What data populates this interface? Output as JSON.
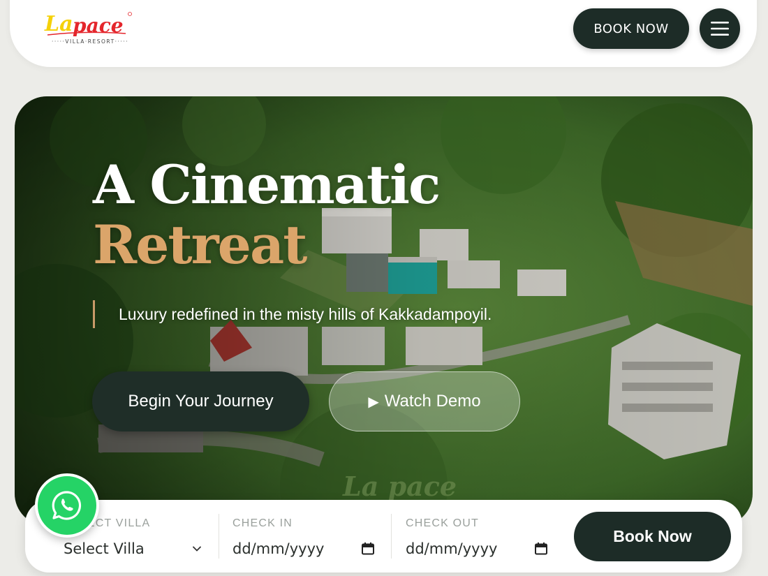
{
  "brand": {
    "logo_text": "La pace",
    "logo_subtext": "VILLA · RESORT",
    "primary_color": "#1d2c27",
    "accent_color": "#dba56a"
  },
  "header": {
    "book_now_label": "BOOK NOW",
    "menu_icon": "hamburger-menu-icon"
  },
  "hero": {
    "title_line1": "A Cinematic",
    "title_line2": "Retreat",
    "tagline": "Luxury redefined in the misty hills of Kakkadampoyil.",
    "primary_cta": "Begin Your Journey",
    "secondary_cta": "Watch Demo",
    "secondary_cta_icon": "play-icon",
    "watermark": "La pace"
  },
  "booking": {
    "villa_label": "SELECT VILLA",
    "villa_value": "Select Villa",
    "checkin_label": "CHECK IN",
    "checkin_placeholder": "dd/mm/yyyy",
    "checkout_label": "CHECK OUT",
    "checkout_placeholder": "dd/mm/yyyy",
    "submit_label": "Book Now"
  },
  "whatsapp": {
    "icon": "whatsapp-icon",
    "color": "#25d366"
  }
}
